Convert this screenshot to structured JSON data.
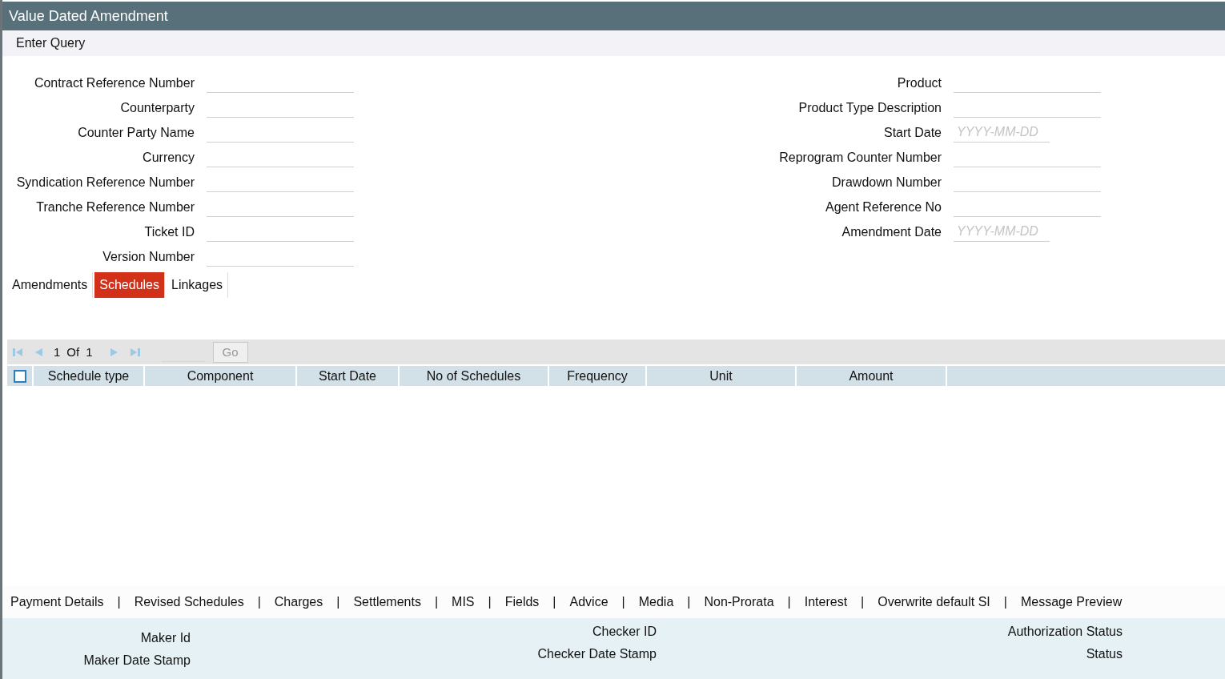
{
  "window": {
    "title": "Value Dated Amendment"
  },
  "toolbar": {
    "action": "Enter Query"
  },
  "form_left": [
    {
      "label": "Contract Reference Number",
      "kind": "text"
    },
    {
      "label": "Counterparty",
      "kind": "text"
    },
    {
      "label": "Counter Party Name",
      "kind": "text"
    },
    {
      "label": "Currency",
      "kind": "text"
    },
    {
      "label": "Syndication Reference Number",
      "kind": "text"
    },
    {
      "label": "Tranche Reference Number",
      "kind": "text"
    },
    {
      "label": "Ticket ID",
      "kind": "text"
    },
    {
      "label": "Version Number",
      "kind": "text"
    }
  ],
  "form_right": [
    {
      "label": "Product",
      "kind": "text"
    },
    {
      "label": "Product Type Description",
      "kind": "text"
    },
    {
      "label": "Start Date",
      "kind": "date",
      "placeholder": "YYYY-MM-DD"
    },
    {
      "label": "Reprogram Counter Number",
      "kind": "text"
    },
    {
      "label": "Drawdown Number",
      "kind": "text"
    },
    {
      "label": "Agent Reference No",
      "kind": "text"
    },
    {
      "label": "Amendment Date",
      "kind": "date",
      "placeholder": "YYYY-MM-DD"
    }
  ],
  "tabs": [
    {
      "label": "Amendments",
      "selected": false
    },
    {
      "label": "Schedules",
      "selected": true
    },
    {
      "label": "Linkages",
      "selected": false
    }
  ],
  "pager": {
    "page": "1",
    "of": "Of",
    "total": "1",
    "go": "Go"
  },
  "table": {
    "select_all_checked": false,
    "columns": [
      "Schedule type",
      "Component",
      "Start Date",
      "No of Schedules",
      "Frequency",
      "Unit",
      "Amount"
    ]
  },
  "footer_links": [
    {
      "kind": "link",
      "label": "Payment Details"
    },
    {
      "kind": "separator",
      "label": "|"
    },
    {
      "kind": "link",
      "label": "Revised Schedules"
    },
    {
      "kind": "separator",
      "label": "|"
    },
    {
      "kind": "link",
      "label": "Charges"
    },
    {
      "kind": "separator",
      "label": "|"
    },
    {
      "kind": "link",
      "label": "Settlements"
    },
    {
      "kind": "separator",
      "label": "|"
    },
    {
      "kind": "link",
      "label": "MIS"
    },
    {
      "kind": "separator",
      "label": "|"
    },
    {
      "kind": "link",
      "label": "Fields"
    },
    {
      "kind": "separator",
      "label": "|"
    },
    {
      "kind": "link",
      "label": "Advice"
    },
    {
      "kind": "separator",
      "label": "|"
    },
    {
      "kind": "link",
      "label": "Media"
    },
    {
      "kind": "separator",
      "label": "|"
    },
    {
      "kind": "link",
      "label": "Non-Prorata"
    },
    {
      "kind": "separator",
      "label": "|"
    },
    {
      "kind": "link",
      "label": "Interest"
    },
    {
      "kind": "separator",
      "label": "|"
    },
    {
      "kind": "link",
      "label": "Overwrite default SI"
    },
    {
      "kind": "separator",
      "label": "|"
    },
    {
      "kind": "link",
      "label": "Message Preview"
    }
  ],
  "audit": [
    [
      "Maker Id",
      "Maker Date Stamp"
    ],
    [
      "Checker ID",
      "Checker Date Stamp"
    ],
    [
      "Authorization Status",
      "Status"
    ]
  ]
}
